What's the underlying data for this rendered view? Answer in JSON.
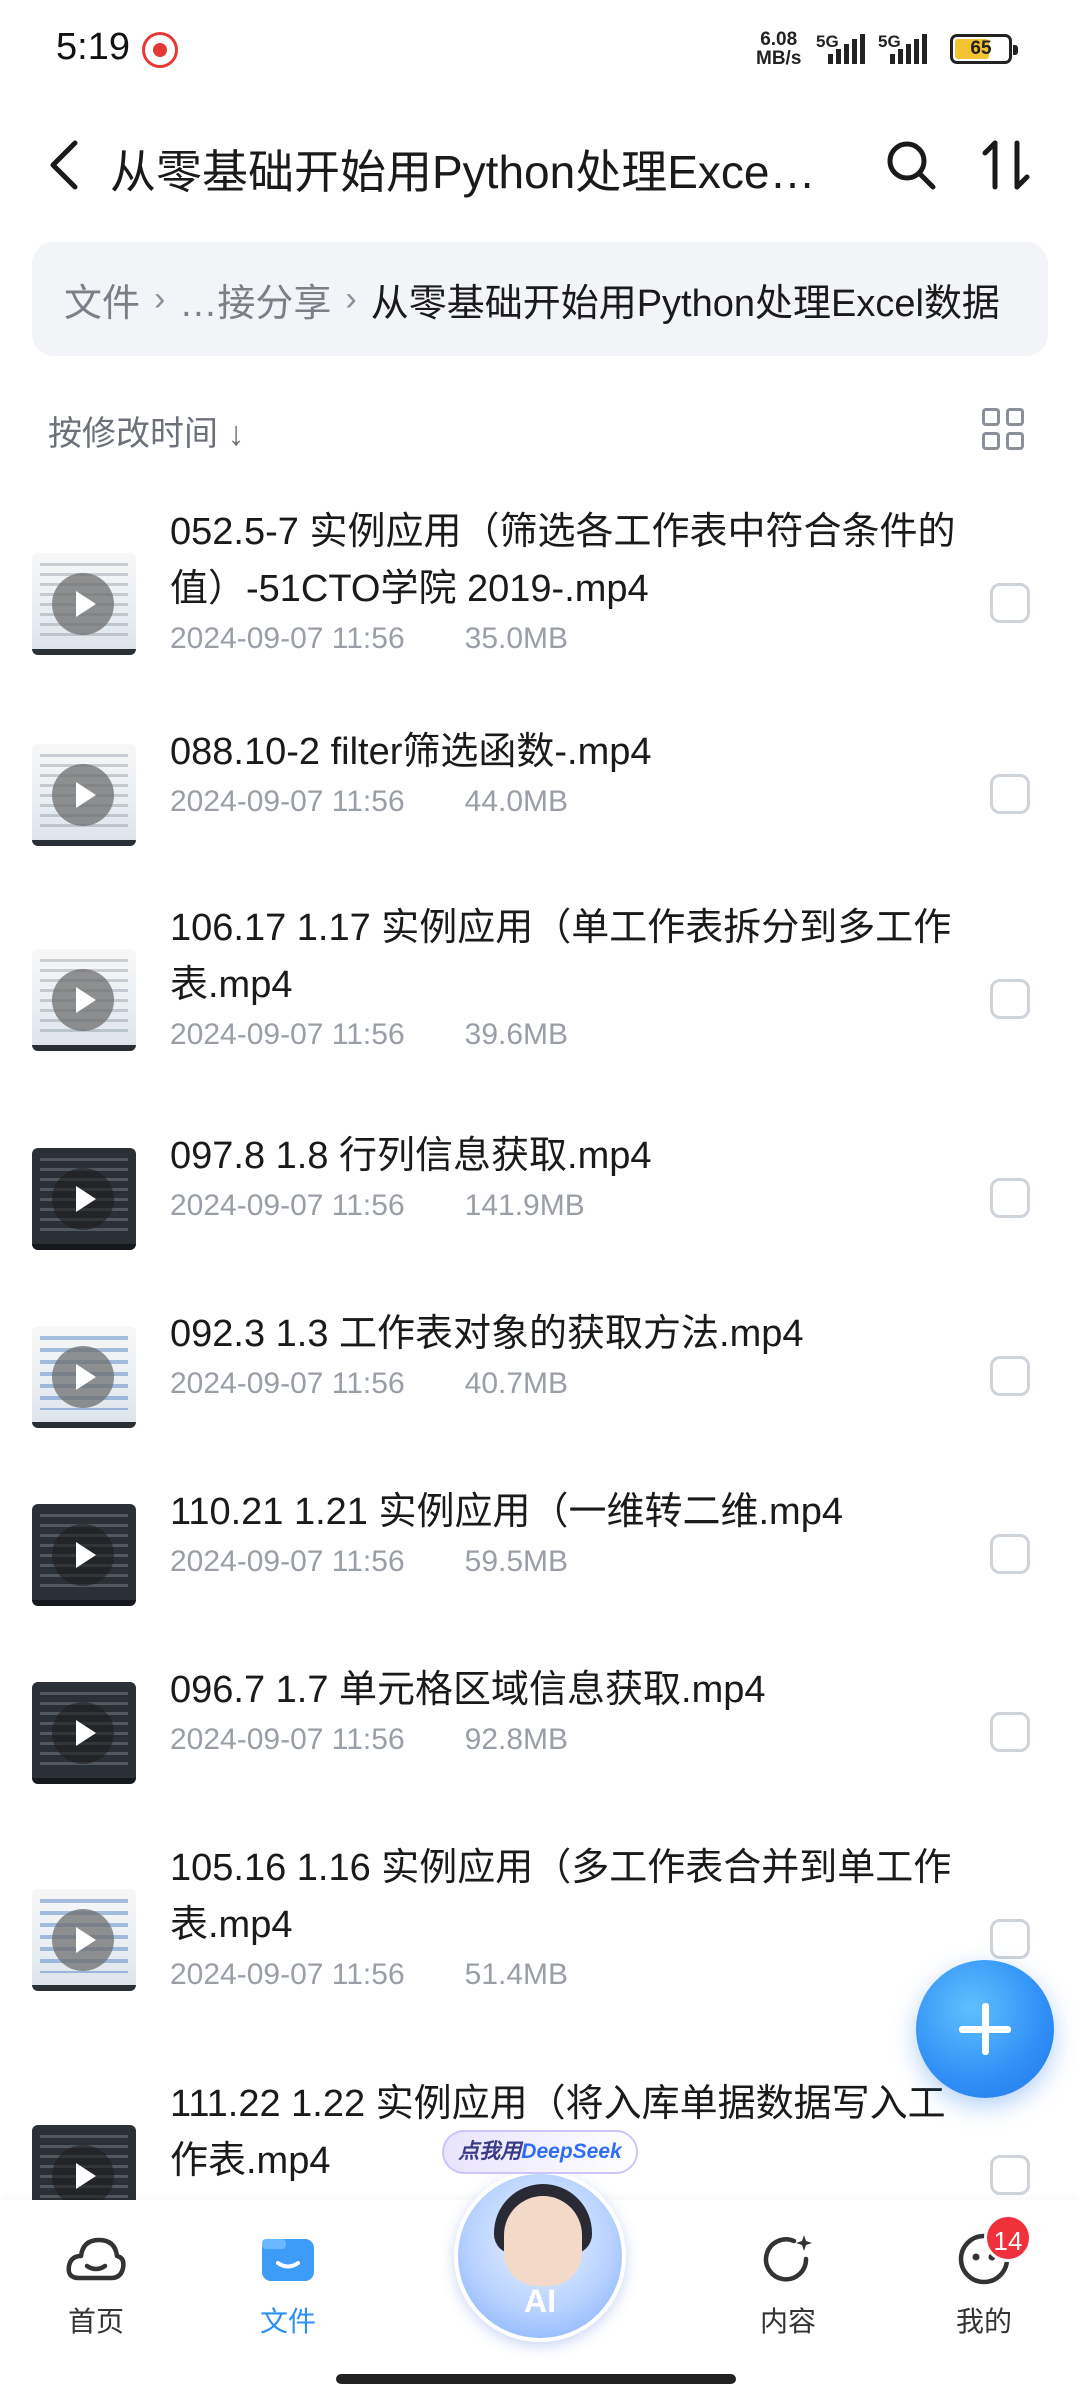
{
  "status_bar": {
    "time": "5:19",
    "net_speed_value": "6.08",
    "net_speed_unit": "MB/s",
    "signal1_tag": "5G",
    "signal2_tag": "5G",
    "battery_level": "65",
    "battery_fraction": 0.65
  },
  "header": {
    "title": "从零基础开始用Python处理Exce…"
  },
  "breadcrumb": {
    "items": [
      "文件",
      "…接分享"
    ],
    "current": "从零基础开始用Python处理Excel数据"
  },
  "sort": {
    "label": "按修改时间 ↓"
  },
  "files": [
    {
      "name": "052.5-7 实例应用（筛选各工作表中符合条件的值）-51CTO学院 2019-.mp4",
      "date": "2024-09-07 11:56",
      "size": "35.0MB",
      "thumb": "light"
    },
    {
      "name": "088.10-2 filter筛选函数-.mp4",
      "date": "2024-09-07 11:56",
      "size": "44.0MB",
      "thumb": "light"
    },
    {
      "name": "106.17 1.17 实例应用（单工作表拆分到多工作表.mp4",
      "date": "2024-09-07 11:56",
      "size": "39.6MB",
      "thumb": "light"
    },
    {
      "name": "097.8 1.8 行列信息获取.mp4",
      "date": "2024-09-07 11:56",
      "size": "141.9MB",
      "thumb": "dark"
    },
    {
      "name": "092.3 1.3 工作表对象的获取方法.mp4",
      "date": "2024-09-07 11:56",
      "size": "40.7MB",
      "thumb": "blue"
    },
    {
      "name": "110.21 1.21 实例应用（一维转二维.mp4",
      "date": "2024-09-07 11:56",
      "size": "59.5MB",
      "thumb": "dark"
    },
    {
      "name": "096.7 1.7 单元格区域信息获取.mp4",
      "date": "2024-09-07 11:56",
      "size": "92.8MB",
      "thumb": "dark"
    },
    {
      "name": "105.16 1.16 实例应用（多工作表合并到单工作表.mp4",
      "date": "2024-09-07 11:56",
      "size": "51.4MB",
      "thumb": "blue"
    },
    {
      "name": "111.22 1.22 实例应用（将入库单据数据写入工作表.mp4",
      "date": "",
      "size": "",
      "thumb": "dark"
    }
  ],
  "ai_button": {
    "bubble_prefix": "点我用",
    "bubble_brand": "DeepSeek",
    "label": "AI"
  },
  "bottom_nav": {
    "home": "首页",
    "files": "文件",
    "content": "内容",
    "mine": "我的",
    "mine_badge": "14"
  },
  "colors": {
    "accent": "#2b8ff3",
    "badge": "#f0303a"
  }
}
